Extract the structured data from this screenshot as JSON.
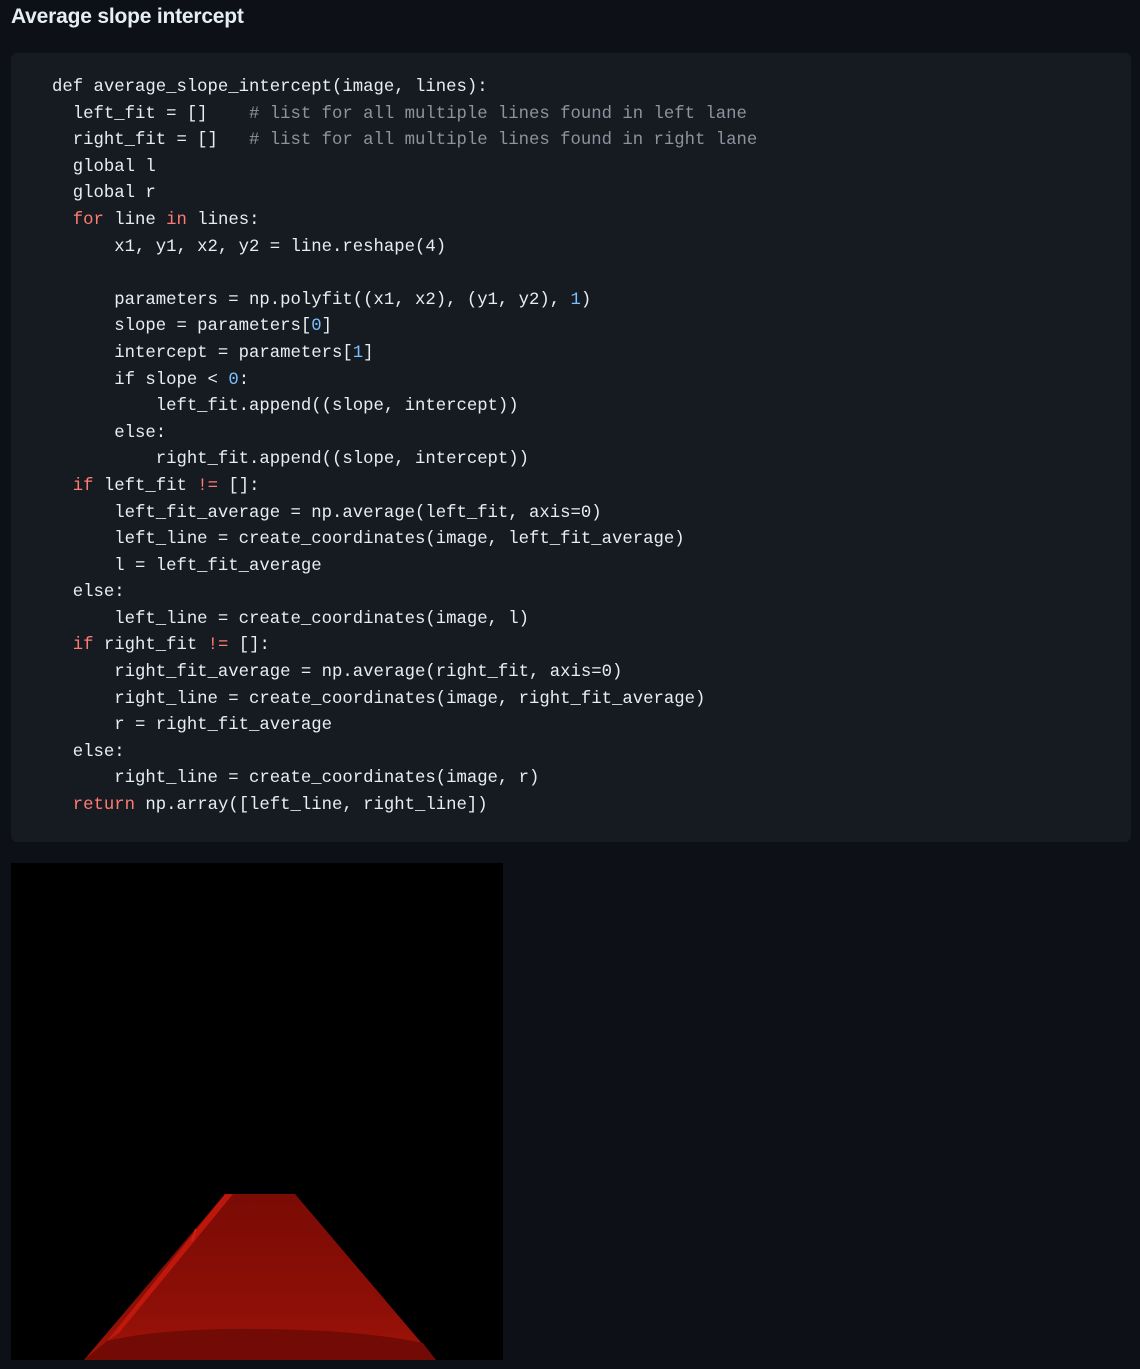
{
  "section": {
    "title": "Average slope intercept"
  },
  "code": {
    "language": "python",
    "lines": [
      [
        {
          "t": "def average_slope_intercept(image, lines):",
          "c": ""
        }
      ],
      [
        {
          "t": "  left_fit = []    ",
          "c": ""
        },
        {
          "t": "# list for all multiple lines found in left lane",
          "c": "cm"
        }
      ],
      [
        {
          "t": "  right_fit = []   ",
          "c": ""
        },
        {
          "t": "# list for all multiple lines found in right lane",
          "c": "cm"
        }
      ],
      [
        {
          "t": "  global l",
          "c": ""
        }
      ],
      [
        {
          "t": "  global r",
          "c": ""
        }
      ],
      [
        {
          "t": "  ",
          "c": ""
        },
        {
          "t": "for",
          "c": "kw"
        },
        {
          "t": " line ",
          "c": ""
        },
        {
          "t": "in",
          "c": "kw"
        },
        {
          "t": " lines:",
          "c": ""
        }
      ],
      [
        {
          "t": "      x1, y1, x2, y2 = line.reshape(4)",
          "c": ""
        }
      ],
      [
        {
          "t": "",
          "c": ""
        }
      ],
      [
        {
          "t": "      parameters = np.polyfit((x1, x2), (y1, y2), ",
          "c": ""
        },
        {
          "t": "1",
          "c": "nu"
        },
        {
          "t": ")",
          "c": ""
        }
      ],
      [
        {
          "t": "      slope = parameters[",
          "c": ""
        },
        {
          "t": "0",
          "c": "nu"
        },
        {
          "t": "]",
          "c": ""
        }
      ],
      [
        {
          "t": "      intercept = parameters[",
          "c": ""
        },
        {
          "t": "1",
          "c": "nu"
        },
        {
          "t": "]",
          "c": ""
        }
      ],
      [
        {
          "t": "      if slope < ",
          "c": ""
        },
        {
          "t": "0",
          "c": "nu"
        },
        {
          "t": ":",
          "c": ""
        }
      ],
      [
        {
          "t": "          left_fit.append((slope, intercept))",
          "c": ""
        }
      ],
      [
        {
          "t": "      else:",
          "c": ""
        }
      ],
      [
        {
          "t": "          right_fit.append((slope, intercept))",
          "c": ""
        }
      ],
      [
        {
          "t": "  ",
          "c": ""
        },
        {
          "t": "if",
          "c": "kw"
        },
        {
          "t": " left_fit ",
          "c": ""
        },
        {
          "t": "!=",
          "c": "kw"
        },
        {
          "t": " []:",
          "c": ""
        }
      ],
      [
        {
          "t": "      left_fit_average = np.average(left_fit, axis=0)",
          "c": ""
        }
      ],
      [
        {
          "t": "      left_line = create_coordinates(image, left_fit_average)",
          "c": ""
        }
      ],
      [
        {
          "t": "      l = left_fit_average",
          "c": ""
        }
      ],
      [
        {
          "t": "  else:",
          "c": ""
        }
      ],
      [
        {
          "t": "      left_line = create_coordinates(image, l)",
          "c": ""
        }
      ],
      [
        {
          "t": "  ",
          "c": ""
        },
        {
          "t": "if",
          "c": "kw"
        },
        {
          "t": " right_fit ",
          "c": ""
        },
        {
          "t": "!=",
          "c": "kw"
        },
        {
          "t": " []:",
          "c": ""
        }
      ],
      [
        {
          "t": "      right_fit_average = np.average(right_fit, axis=0)",
          "c": ""
        }
      ],
      [
        {
          "t": "      right_line = create_coordinates(image, right_fit_average)",
          "c": ""
        }
      ],
      [
        {
          "t": "      r = right_fit_average",
          "c": ""
        }
      ],
      [
        {
          "t": "  else:",
          "c": ""
        }
      ],
      [
        {
          "t": "      right_line = create_coordinates(image, r)",
          "c": ""
        }
      ],
      [
        {
          "t": "  ",
          "c": ""
        },
        {
          "t": "return",
          "c": "kw"
        },
        {
          "t": " np.array([left_line, right_line])",
          "c": ""
        }
      ]
    ]
  },
  "image": {
    "subject": "masked road region (red) on black background",
    "colors": {
      "background": "#000000",
      "region": "#8a0d06",
      "edge": "#d81e10"
    }
  },
  "theme": {
    "page_bg": "#0d1117",
    "code_bg": "#161b22",
    "text": "#e6edf3",
    "keyword": "#ff7b72",
    "comment": "#8b949e",
    "number": "#79c0ff"
  }
}
